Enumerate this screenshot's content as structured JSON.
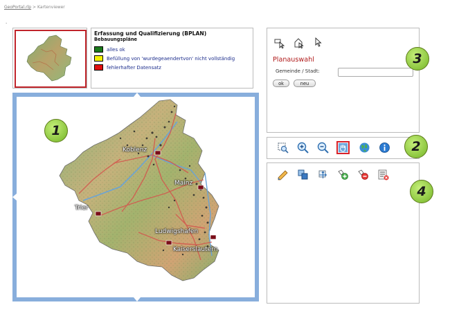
{
  "breadcrumb": {
    "link": "GeoPortal.rlp",
    "separator": ">",
    "current": "Kartenviewer"
  },
  "stray_mark": ".",
  "legend": {
    "title": "Erfassung und Qualifizierung (BPLAN)",
    "subtitle": "Bebauungspläne",
    "items": [
      {
        "label": "alles ok",
        "color": "#1b7a1b"
      },
      {
        "label": "Befüllung von 'wurdegeaendertvon' nicht vollständig",
        "color": "#f4f000"
      },
      {
        "label": "fehlerhafter Datensatz",
        "color": "#e01010"
      }
    ]
  },
  "map": {
    "cities": [
      "Koblenz",
      "Mainz",
      "Trier",
      "Ludwigshafen",
      "Kaiserslautern"
    ],
    "frame_color": "#88aedc"
  },
  "planauswahl": {
    "title": "Planauswahl",
    "field_label": "Gemeinde / Stadt:",
    "field_value": "",
    "ok_label": "ok",
    "new_label": "neu",
    "tool_icons": [
      "select-arrow-icon",
      "select-house-icon",
      "pointer-cursor-icon"
    ]
  },
  "toolbar_nav": {
    "icons": [
      "zoom-box-icon",
      "zoom-in-icon",
      "zoom-out-icon",
      "pan-hand-icon",
      "globe-icon",
      "info-icon"
    ]
  },
  "toolbar_edit": {
    "icons": [
      "edit-pencil-icon",
      "copy-layers-icon",
      "move-feature-icon",
      "add-feature-icon",
      "remove-feature-icon",
      "delete-list-icon"
    ]
  },
  "badges": [
    "1",
    "2",
    "3",
    "4"
  ],
  "colors": {
    "plan_title": "#b01a1a",
    "badge_fill": "#8cc63f",
    "ok": "#1b7a1b",
    "warn": "#f4f000",
    "error": "#e01010"
  }
}
